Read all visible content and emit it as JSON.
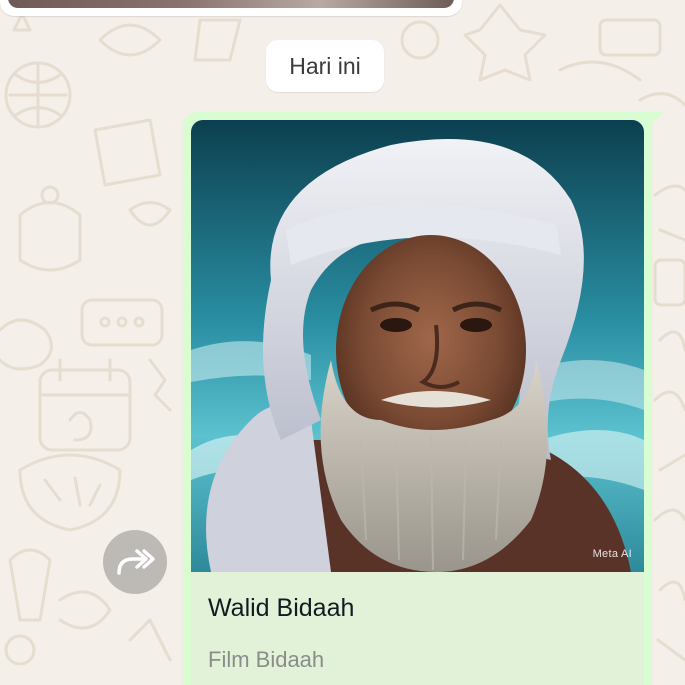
{
  "chat": {
    "date_label": "Hari ini"
  },
  "link_preview": {
    "title": "Walid Bidaah",
    "subtitle": "Film Bidaah",
    "watermark": "Meta AI",
    "image_alt": "portrait-of-elderly-man-with-white-turban-and-beard"
  },
  "icons": {
    "forward": "forward-arrow-icon"
  },
  "colors": {
    "wallpaper": "#f4efe8",
    "outgoing_bubble": "#d9fdd3",
    "link_card": "#e1f2d8",
    "forward_button": "#bdbab6"
  }
}
